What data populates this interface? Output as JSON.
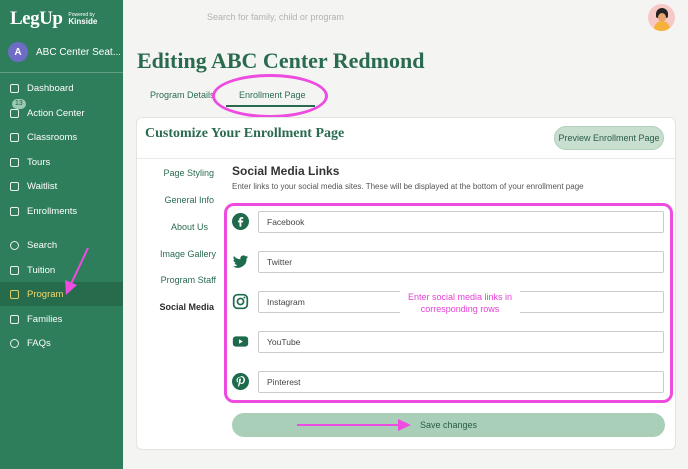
{
  "brand": {
    "logo": "LegUp",
    "powered_by": "Powered by",
    "partner": "Kinside"
  },
  "org": {
    "initial": "A",
    "name": "ABC Center Seat..."
  },
  "sidebar": {
    "items": [
      {
        "label": "Dashboard",
        "icon": "dashboard-icon"
      },
      {
        "label": "Action Center",
        "icon": "action-center-icon",
        "badge": "13"
      },
      {
        "label": "Classrooms",
        "icon": "classrooms-icon"
      },
      {
        "label": "Tours",
        "icon": "tours-icon"
      },
      {
        "label": "Waitlist",
        "icon": "waitlist-icon"
      },
      {
        "label": "Enrollments",
        "icon": "enrollments-icon"
      },
      {
        "label": "Search",
        "icon": "search-icon"
      },
      {
        "label": "Tuition",
        "icon": "tuition-icon"
      },
      {
        "label": "Program",
        "icon": "program-icon",
        "active": true
      },
      {
        "label": "Families",
        "icon": "families-icon"
      },
      {
        "label": "FAQs",
        "icon": "faq-icon"
      }
    ]
  },
  "header": {
    "search_placeholder": "Search for family, child or program"
  },
  "page": {
    "title": "Editing ABC Center Redmond",
    "tabs": [
      "Program Details",
      "Enrollment Page"
    ],
    "active_tab": "Enrollment Page"
  },
  "card": {
    "title": "Customize Your Enrollment Page",
    "preview_label": "Preview Enrollment Page",
    "sub_nav": [
      "Page Styling",
      "General Info",
      "About Us",
      "Image Gallery",
      "Program Staff",
      "Social Media"
    ],
    "active_sub_nav": "Social Media"
  },
  "social": {
    "title": "Social Media Links",
    "description": "Enter links to your social media sites. These will be displayed at the bottom of your enrollment page",
    "fields": [
      {
        "placeholder": "Facebook",
        "icon": "facebook-icon"
      },
      {
        "placeholder": "Twitter",
        "icon": "twitter-icon"
      },
      {
        "placeholder": "Instagram",
        "icon": "instagram-icon"
      },
      {
        "placeholder": "YouTube",
        "icon": "youtube-icon"
      },
      {
        "placeholder": "Pinterest",
        "icon": "pinterest-icon"
      }
    ],
    "annotation": "Enter social media links in corresponding rows",
    "save_label": "Save changes"
  },
  "colors": {
    "sidebar": "#2e7d5b",
    "accent_text": "#2a6b4f",
    "active_nav_text": "#f3d96a",
    "annotation": "#ee4ce0",
    "button": "#aacfb8"
  }
}
